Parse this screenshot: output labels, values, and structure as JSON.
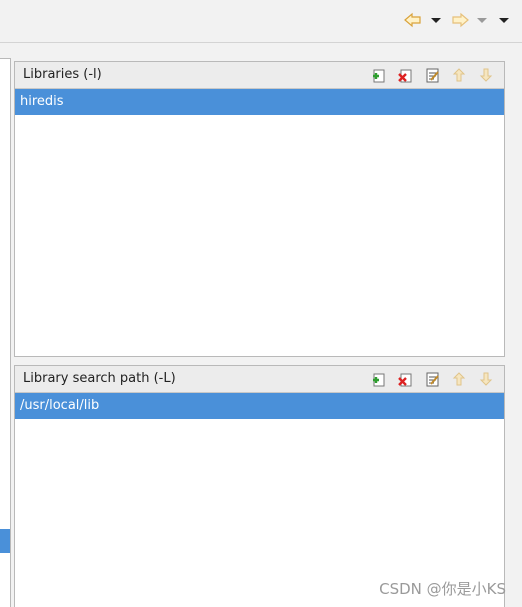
{
  "colors": {
    "selection": "#4a90d9",
    "toolbar_bg": "#f2f2f2",
    "arrow": "#e8b04a"
  },
  "toolbar": {
    "back_icon": "back-arrow-icon",
    "forward_icon": "forward-arrow-icon",
    "menu_icon": "view-menu-icon"
  },
  "libraries": {
    "title": "Libraries (-l)",
    "items": [
      "hiredis"
    ],
    "tools": [
      "add-icon",
      "delete-icon",
      "edit-icon",
      "move-up-icon",
      "move-down-icon"
    ]
  },
  "search_path": {
    "title": "Library search path (-L)",
    "items": [
      "/usr/local/lib"
    ],
    "tools": [
      "add-icon",
      "delete-icon",
      "edit-icon",
      "move-up-icon",
      "move-down-icon"
    ]
  },
  "watermark": "CSDN @你是小KS"
}
